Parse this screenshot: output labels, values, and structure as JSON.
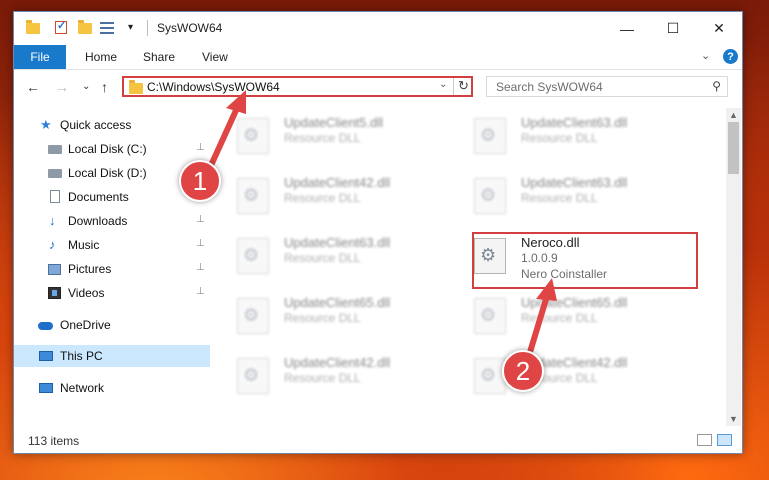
{
  "window": {
    "title": "SysWOW64",
    "minimize": "—",
    "maximize": "☐",
    "close": "✕"
  },
  "ribbon": {
    "tabs": [
      "File",
      "Home",
      "Share",
      "View"
    ],
    "collapse": "⌄",
    "help": "?"
  },
  "nav": {
    "back": "←",
    "forward": "→",
    "recent": "⌄",
    "up": "↑",
    "address": "C:\\Windows\\SysWOW64",
    "dropdown": "⌄",
    "refresh": "↻",
    "search_placeholder": "Search SysWOW64",
    "search_glyph": "⚲"
  },
  "sidebar": {
    "items": [
      {
        "label": "Quick access",
        "icon": "star-icon",
        "pinned": false
      },
      {
        "label": "Local Disk (C:)",
        "icon": "drive-icon",
        "pinned": true
      },
      {
        "label": "Local Disk (D:)",
        "icon": "drive-icon",
        "pinned": false
      },
      {
        "label": "Documents",
        "icon": "documents-icon",
        "pinned": true
      },
      {
        "label": "Downloads",
        "icon": "downloads-icon",
        "pinned": true
      },
      {
        "label": "Music",
        "icon": "music-icon",
        "pinned": true
      },
      {
        "label": "Pictures",
        "icon": "pictures-icon",
        "pinned": true
      },
      {
        "label": "Videos",
        "icon": "videos-icon",
        "pinned": true
      },
      {
        "label": "OneDrive",
        "icon": "onedrive-icon",
        "pinned": false
      },
      {
        "label": "This PC",
        "icon": "this-pc-icon",
        "pinned": false,
        "selected": true
      },
      {
        "label": "Network",
        "icon": "network-icon",
        "pinned": false
      }
    ],
    "pin_glyph": "📌"
  },
  "files": [
    {
      "name": "UpdateClient5.dll",
      "desc": "Resource DLL",
      "blurred": true
    },
    {
      "name": "UpdateClient63.dll",
      "desc": "Resource DLL",
      "blurred": true
    },
    {
      "name": "UpdateClient42.dll",
      "desc": "Resource DLL",
      "blurred": true
    },
    {
      "name": "UpdateClient63.dll",
      "desc": "Resource DLL",
      "blurred": true
    },
    {
      "name": "UpdateClient63.dll",
      "desc": "Resource DLL",
      "blurred": true
    },
    {
      "name": "Neroco.dll",
      "desc": "1.0.0.9",
      "desc2": "Nero Coinstaller",
      "blurred": false,
      "highlighted": true
    },
    {
      "name": "UpdateClient65.dll",
      "desc": "Resource DLL",
      "blurred": true
    },
    {
      "name": "UpdateClient65.dll",
      "desc": "Resource DLL",
      "blurred": true
    },
    {
      "name": "UpdateClient42.dll",
      "desc": "Resource DLL",
      "blurred": true
    },
    {
      "name": "UpdateClient42.dll",
      "desc": "Resource DLL",
      "blurred": true
    }
  ],
  "status": {
    "count": "113 items"
  },
  "annotations": {
    "step1": "1",
    "step2": "2",
    "color": "#e04545"
  }
}
